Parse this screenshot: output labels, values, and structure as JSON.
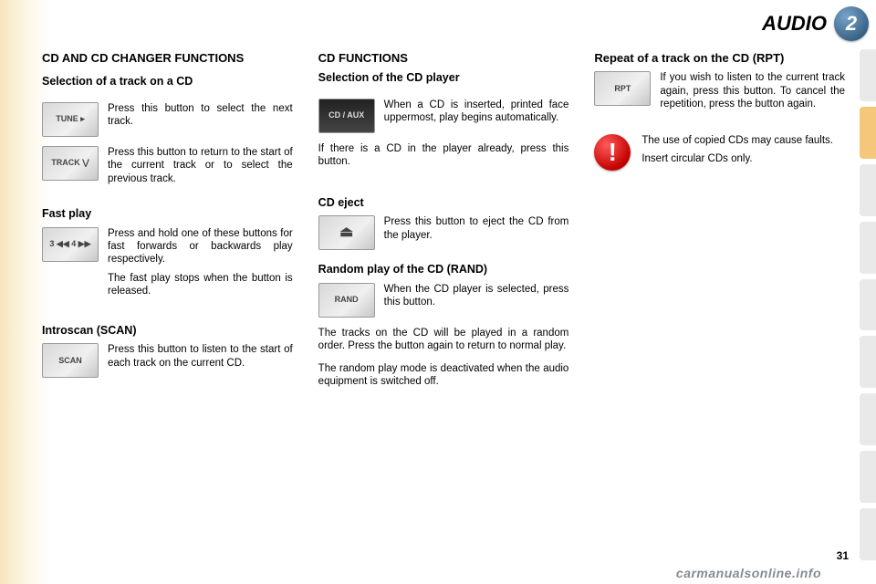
{
  "header": {
    "title": "AUDIO",
    "chapter": "2"
  },
  "pagenum": "31",
  "watermark": "carmanualsonline.info",
  "col1": {
    "h1": "CD AND CD CHANGER FUNCTIONS",
    "s1": {
      "heading": "Selection of a track on a CD",
      "b1": {
        "thumb": "TUNE ▸",
        "text": "Press this button to select the next track."
      },
      "b2": {
        "thumb": "TRACK ⋁",
        "text": "Press this button to return to the start of the current track or to select the previous track."
      }
    },
    "s2": {
      "heading": "Fast play",
      "b1": {
        "thumb": "3 ◀◀ 4 ▶▶",
        "text1": "Press and hold one of these buttons for fast forwards or backwards play respectively.",
        "text2": "The fast play stops when the button is released."
      }
    },
    "s3": {
      "heading": "Introscan (SCAN)",
      "b1": {
        "thumb": "SCAN",
        "text": "Press this button to listen to the start of each track on the current CD."
      }
    }
  },
  "col2": {
    "h1": "CD FUNCTIONS",
    "s1": {
      "heading": "Selection of the CD player",
      "b1": {
        "thumb": "CD / AUX",
        "text": "When a CD is inserted, printed face uppermost, play begins automatically."
      },
      "p2": "If there is a CD in the player already, press this button."
    },
    "s2": {
      "heading": "CD eject",
      "b1": {
        "thumb": "⏏",
        "text": "Press this button to eject the CD from the player."
      }
    },
    "s3": {
      "heading": "Random play of the CD (RAND)",
      "b1": {
        "thumb": "RAND",
        "text": "When the CD player is selected, press this button."
      },
      "p2": "The tracks on the CD will be played in a random order. Press the button again to return to normal play.",
      "p3": "The random play mode is deactivated when the audio equipment is switched off."
    }
  },
  "col3": {
    "s1": {
      "heading": "Repeat of a track on the CD (RPT)",
      "b1": {
        "thumb": "RPT",
        "text": "If you wish to listen to the current track again, press this button. To cancel the repetition, press the button again."
      }
    },
    "warn": {
      "line1": "The use of copied CDs may cause faults.",
      "line2": "Insert circular CDs only."
    }
  }
}
